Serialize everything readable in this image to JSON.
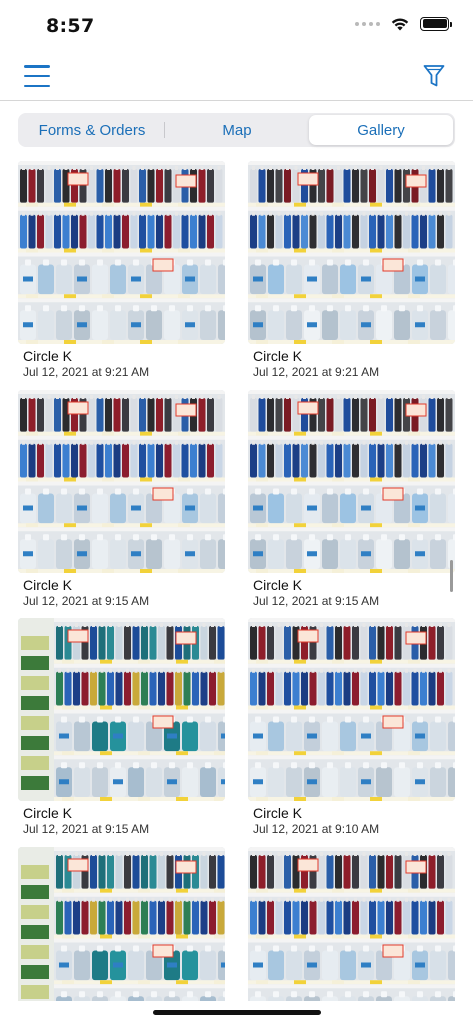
{
  "status_bar": {
    "time": "8:57",
    "icons": [
      "signal-dots",
      "wifi-icon",
      "battery-icon"
    ]
  },
  "nav": {
    "menu_icon": "hamburger-menu-icon",
    "filter_icon": "filter-funnel-icon",
    "accent_color": "#1b74c5"
  },
  "tabs": [
    {
      "label": "Forms & Orders",
      "active": false
    },
    {
      "label": "Map",
      "active": false
    },
    {
      "label": "Gallery",
      "active": true
    }
  ],
  "gallery": {
    "items": [
      {
        "store": "Circle K",
        "date": "Jul 12, 2021 at 9:21 AM",
        "variant": "a"
      },
      {
        "store": "Circle K",
        "date": "Jul 12, 2021 at 9:21 AM",
        "variant": "b"
      },
      {
        "store": "Circle K",
        "date": "Jul 12, 2021 at 9:15 AM",
        "variant": "a"
      },
      {
        "store": "Circle K",
        "date": "Jul 12, 2021 at 9:15 AM",
        "variant": "b"
      },
      {
        "store": "Circle K",
        "date": "Jul 12, 2021 at 9:15 AM",
        "variant": "c"
      },
      {
        "store": "Circle K",
        "date": "Jul 12, 2021 at 9:10 AM",
        "variant": "a"
      },
      {
        "store": "",
        "date": "",
        "variant": "c"
      },
      {
        "store": "",
        "date": "",
        "variant": "a"
      }
    ]
  }
}
